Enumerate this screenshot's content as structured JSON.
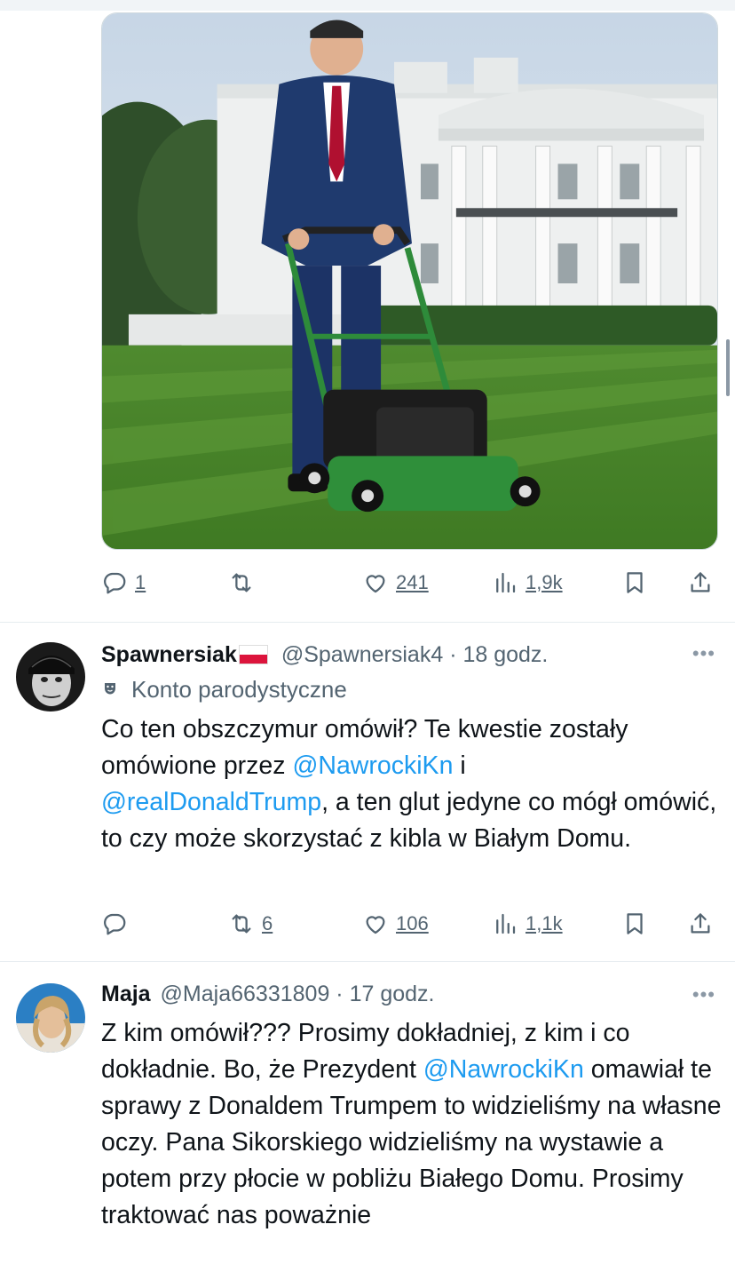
{
  "post": {
    "stats": {
      "replies": "1",
      "retweets": "",
      "likes": "241",
      "views": "1,9k"
    }
  },
  "replies": [
    {
      "name": "Spawnersiak",
      "handle": "@Spawnersiak4",
      "sep": "·",
      "time": "18 godz.",
      "badge": "Konto parodystyczne",
      "text_parts": {
        "p1": "Co ten obszczymur omówił? Te kwestie zostały omówione przez ",
        "m1": "@NawrockiKn",
        "p2": " i ",
        "m2": "@realDonaldTrump",
        "p3": ", a ten glut jedyne co mógł omówić, to czy może skorzystać z kibla w Białym Domu."
      },
      "stats": {
        "replies": "",
        "retweets": "6",
        "likes": "106",
        "views": "1,1k"
      }
    },
    {
      "name": "Maja",
      "handle": "@Maja66331809",
      "sep": "·",
      "time": "17 godz.",
      "text_parts": {
        "p1": "Z kim omówił??? Prosimy dokładniej, z kim i co dokładnie. Bo, że Prezydent ",
        "m1": "@NawrockiKn",
        "p2": " omawiał te sprawy z Donaldem Trumpem to widzieliśmy na własne oczy. Pana Sikorskiego widzieliśmy na wystawie a potem przy płocie w pobliżu Białego Domu. Prosimy traktować  nas poważnie"
      }
    }
  ],
  "icons": {
    "reply": "reply-icon",
    "retweet": "retweet-icon",
    "like": "heart-icon",
    "views": "views-icon",
    "bookmark": "bookmark-icon",
    "share": "share-icon",
    "more": "more-icon"
  },
  "colors": {
    "accent": "#1d9bf0",
    "muted": "#536471",
    "text": "#0f1419"
  }
}
